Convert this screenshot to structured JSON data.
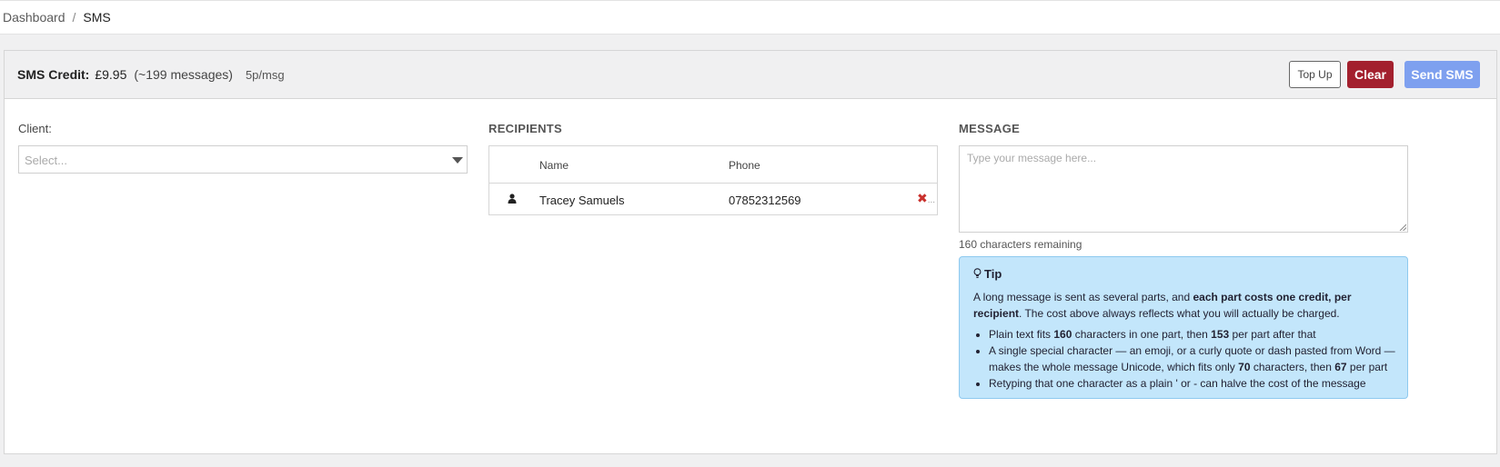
{
  "breadcrumb": {
    "items": [
      "Dashboard"
    ],
    "separator": "/",
    "current": "SMS"
  },
  "credit": {
    "label": "SMS Credit:",
    "amount": "£9.95",
    "approx": "(~199 messages)",
    "rate": "5p/msg"
  },
  "actions": {
    "top_up": "Top Up",
    "clear": "Clear",
    "send": "Send SMS"
  },
  "client": {
    "label": "Client:",
    "placeholder": "Select..."
  },
  "recipients": {
    "heading": "RECIPIENTS",
    "columns": [
      "Name",
      "Phone"
    ],
    "rows": [
      {
        "name": "Tracey Samuels",
        "phone": "07852312569",
        "icon": "user-icon"
      }
    ],
    "remove_icon": "✖",
    "more": "..."
  },
  "message": {
    "heading": "MESSAGE",
    "placeholder": "Type your message here...",
    "value": "",
    "remaining": "160 characters remaining"
  },
  "tip": {
    "icon": "lightbulb-icon",
    "title": "Tip",
    "para_start": "A long message is sent as several parts, and ",
    "para_bold": "each part costs one credit, per recipient",
    "para_end": ". The cost above always reflects what you will actually be charged.",
    "bullets": [
      {
        "t1": "Plain text fits ",
        "b1": "160",
        "t2": " characters in one part, then ",
        "b2": "153",
        "t3": " per part after that"
      },
      {
        "t1": "A single special character — an emoji, or a curly quote or dash pasted from Word — makes the whole message Unicode, which fits only ",
        "b1": "70",
        "t2": " characters, then ",
        "b2": "67",
        "t3": " per part"
      },
      {
        "t1": "Retyping that one character as a plain ' or - can halve the cost of the message"
      }
    ]
  },
  "colors": {
    "clear_button": "#a3202e",
    "send_button": "#7ea0ef",
    "tip_background": "#c3e6fb",
    "remove_icon": "#c9302c"
  }
}
